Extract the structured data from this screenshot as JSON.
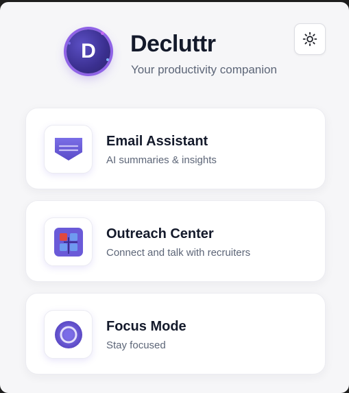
{
  "header": {
    "logo_letter": "D",
    "title": "Decluttr",
    "subtitle": "Your productivity companion",
    "theme_toggle_icon": "sun-icon"
  },
  "cards": [
    {
      "title": "Email Assistant",
      "description": "AI summaries & insights",
      "icon": "envelope-icon"
    },
    {
      "title": "Outreach Center",
      "description": "Connect and talk with recruiters",
      "icon": "grid-icon"
    },
    {
      "title": "Focus Mode",
      "description": "Stay focused",
      "icon": "target-icon"
    }
  ],
  "colors": {
    "accent": "#6a5ad8",
    "accent_light": "#8f63e6",
    "title_text": "#141a2b",
    "muted_text": "#5c6577",
    "background": "#f6f6f8"
  }
}
